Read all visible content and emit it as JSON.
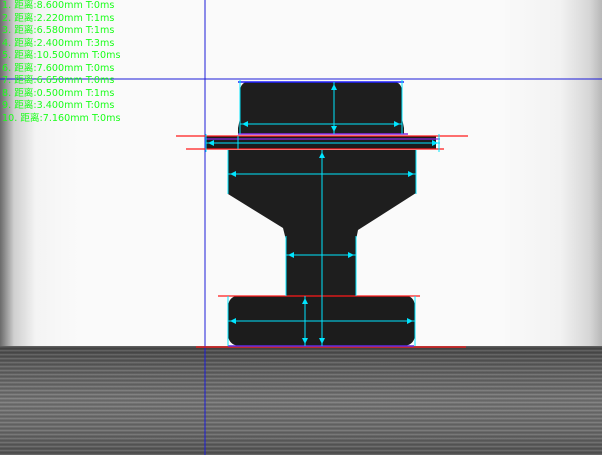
{
  "window": {
    "width": 602,
    "height": 455
  },
  "colors": {
    "readout_text": "#1aff1a",
    "crosshair": "#1c1cd8",
    "measure_line": "#00e5ff",
    "edge_red": "#ff1a1a",
    "edge_blue": "#2020ff",
    "edge_purple": "#8a2be2",
    "part_fill": "#1e1e1e"
  },
  "measurements": [
    {
      "index": "1.",
      "label": "距离:8.600mm",
      "time": "T:0ms"
    },
    {
      "index": "2.",
      "label": "距离:2.220mm",
      "time": "T:1ms"
    },
    {
      "index": "3.",
      "label": "距离:6.580mm",
      "time": "T:1ms"
    },
    {
      "index": "4.",
      "label": "距离:2.400mm",
      "time": "T:3ms"
    },
    {
      "index": "5.",
      "label": "距离:10.500mm",
      "time": "T:0ms"
    },
    {
      "index": "6.",
      "label": "距离:7.600mm",
      "time": "T:0ms"
    },
    {
      "index": "7.",
      "label": "距离:6.650mm",
      "time": "T:0ms"
    },
    {
      "index": "8.",
      "label": "距离:0.500mm",
      "time": "T:1ms"
    },
    {
      "index": "9.",
      "label": "距离:3.400mm",
      "time": "T:0ms"
    },
    {
      "index": "10.",
      "label": "距离:7.160mm",
      "time": "T:0ms"
    }
  ]
}
